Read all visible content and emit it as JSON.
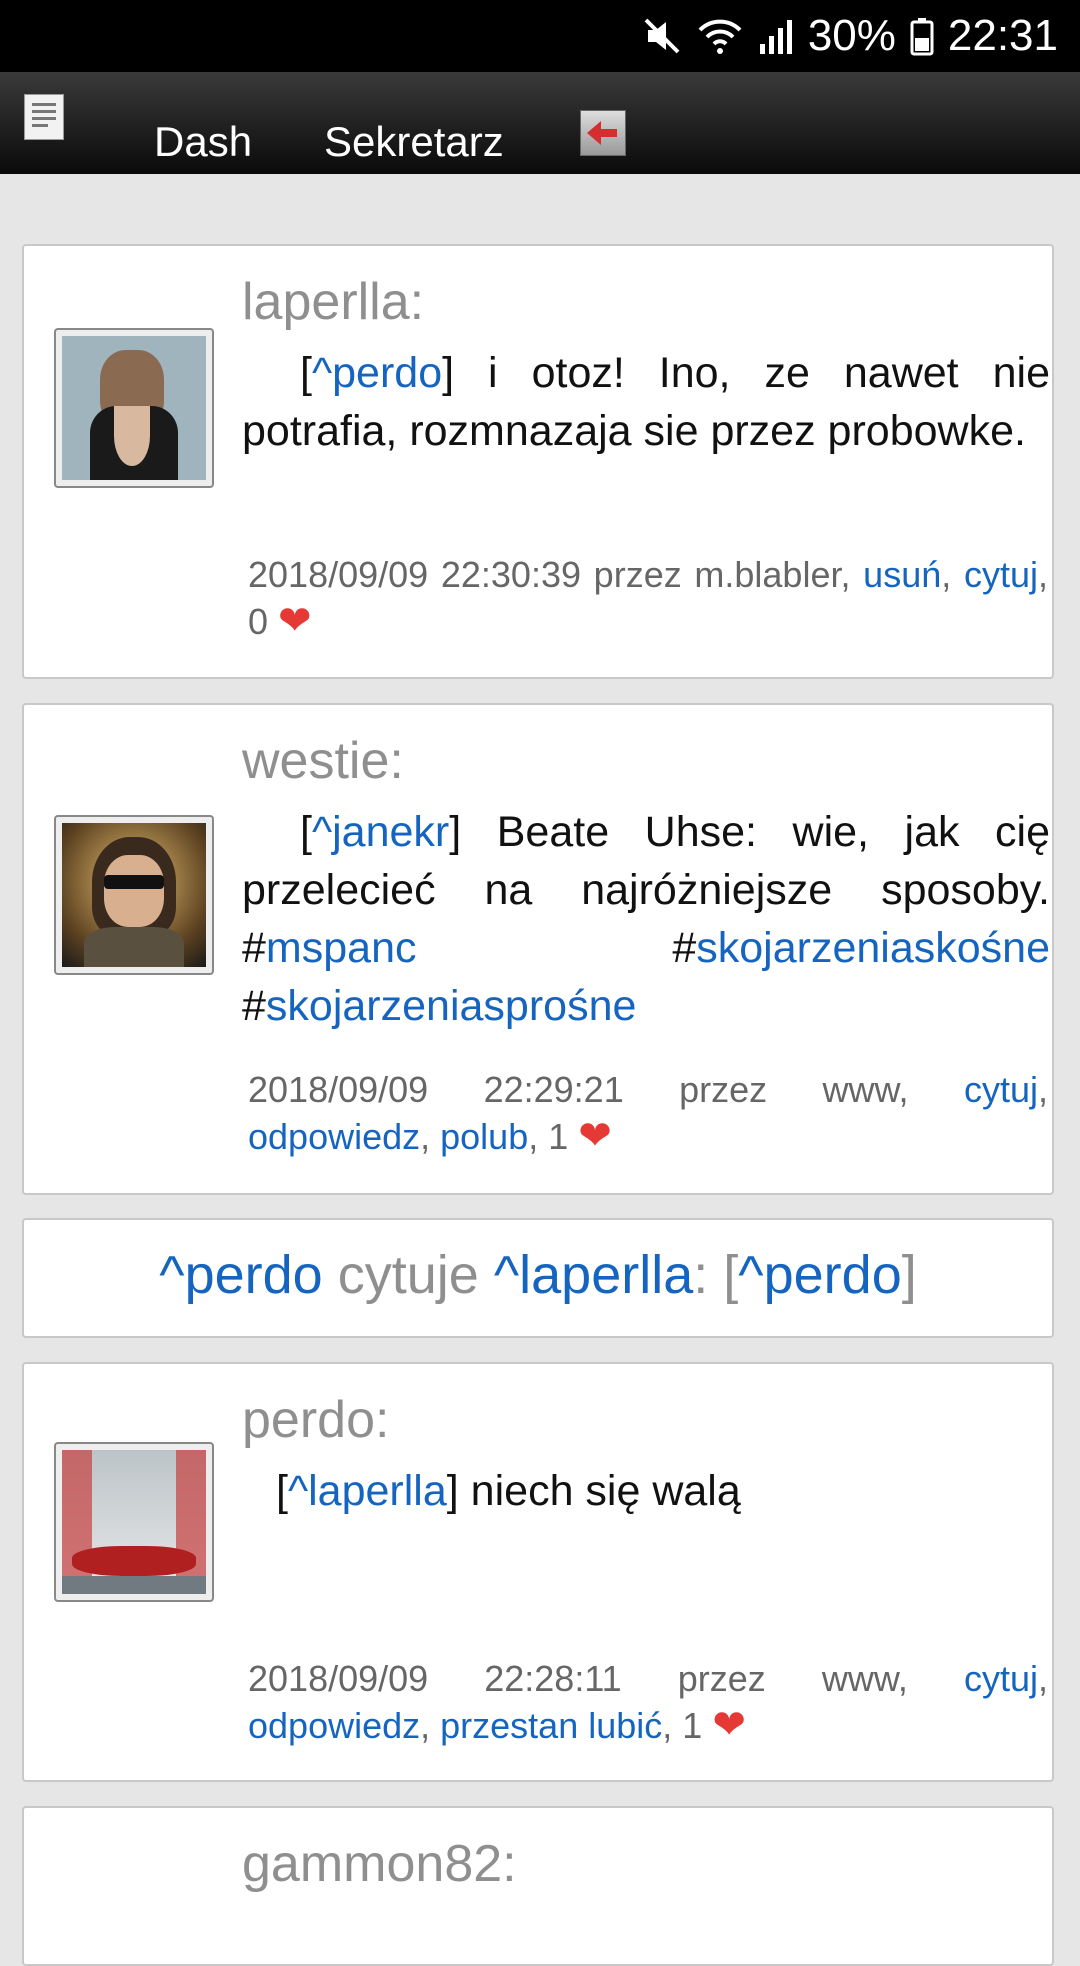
{
  "status_bar": {
    "battery": "30%",
    "time": "22:31"
  },
  "nav": {
    "items": [
      "Dash",
      "Sekretarz"
    ]
  },
  "posts": [
    {
      "author": "laperlla:",
      "mention": "^perdo",
      "text": " i otoz! Ino, ze nawet nie potrafia, rozmnazaja sie przez probowke.",
      "meta_prefix": "2018/09/09 22:30:39 przez m.blabler, ",
      "link1": "usuń",
      "link2": "cytuj",
      "count": "0"
    },
    {
      "author": "westie:",
      "mention": "^janekr",
      "text": " Beate Uhse: wie, jak cię przelecieć na najróżniejsze sposoby. ",
      "tag1": "mspanc",
      "tag2": "skojarzeniaskośne",
      "tag3": "skojarzeniasprośne",
      "meta_prefix": "2018/09/09 22:29:21 przez www, ",
      "link1": "cytuj",
      "link2": "odpowiedz",
      "link3": "polub",
      "count": "1"
    },
    {
      "author": "perdo:",
      "mention": "^laperlla",
      "text": " niech się walą",
      "meta_prefix": "2018/09/09 22:28:11 przez www, ",
      "link1": "cytuj",
      "link2": "odpowiedz",
      "link3": "przestan lubić",
      "count": "1"
    },
    {
      "author": "gammon82:"
    }
  ],
  "quote_bar": {
    "user1": "^perdo",
    "verb": "cytuje",
    "user2": "^laperlla",
    "target": "^perdo"
  },
  "colors": {
    "link": "#1565c0",
    "heart": "#e53935",
    "author": "#8f8f8f"
  }
}
